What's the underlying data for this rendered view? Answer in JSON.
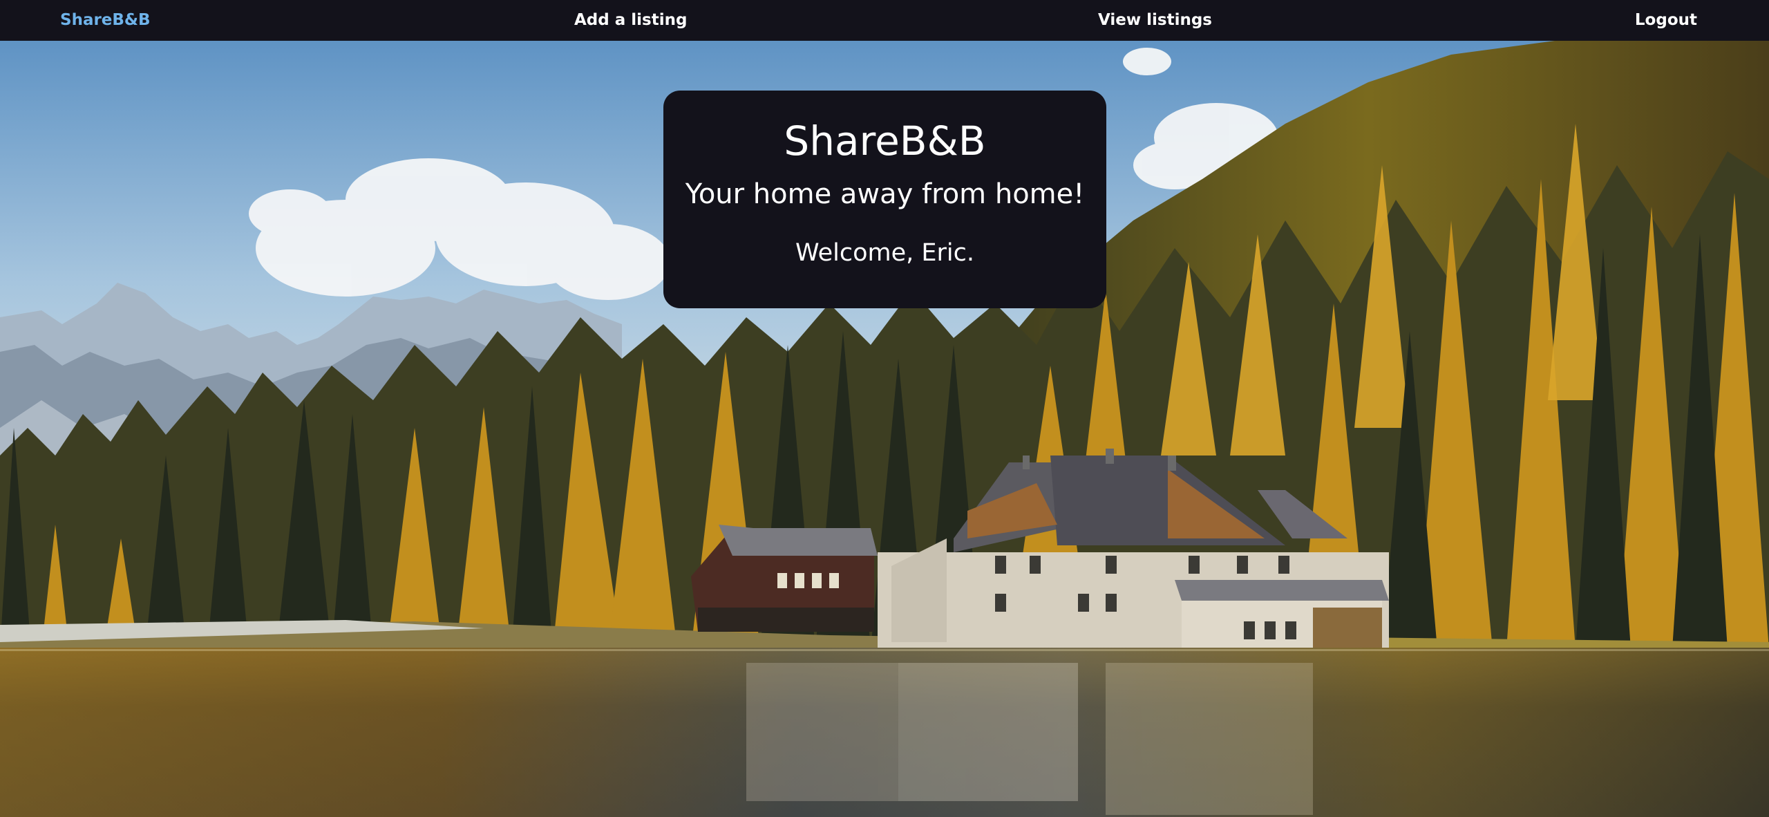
{
  "nav": {
    "brand": "ShareB&B",
    "add_listing": "Add a listing",
    "view_listings": "View listings",
    "logout": "Logout"
  },
  "hero": {
    "title": "ShareB&B",
    "tagline": "Your home away from home!",
    "welcome": "Welcome, Eric."
  },
  "colors": {
    "navbar_bg": "#13121b",
    "brand": "#6fb3ea",
    "card_bg": "#13121b",
    "text": "#ffffff"
  }
}
